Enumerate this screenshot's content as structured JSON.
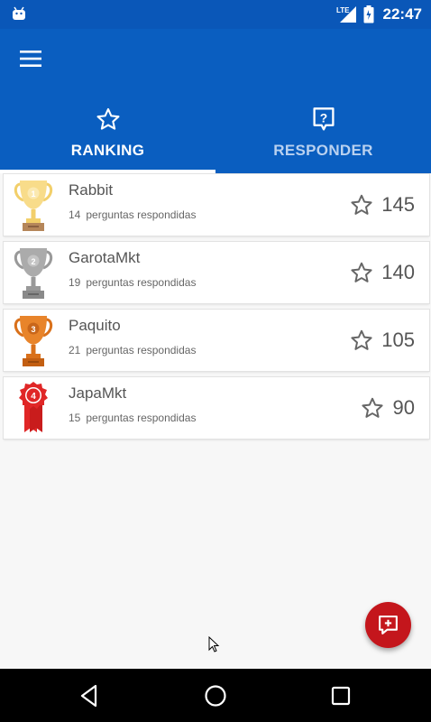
{
  "status_bar": {
    "time": "22:47",
    "network_label": "LTE",
    "icons": [
      "android-icon",
      "lte-signal-icon",
      "battery-icon"
    ]
  },
  "app_bar": {
    "menu_icon": "hamburger-menu-icon",
    "tabs": [
      {
        "label": "RANKING",
        "icon": "star-outline-icon",
        "active": true
      },
      {
        "label": "RESPONDER",
        "icon": "question-bubble-icon",
        "active": false
      }
    ]
  },
  "ranking": {
    "count_suffix": "perguntas respondidas",
    "items": [
      {
        "position": "1",
        "name": "Rabbit",
        "answered": "14",
        "points": "145",
        "badge": "gold-trophy"
      },
      {
        "position": "2",
        "name": "GarotaMkt",
        "answered": "19",
        "points": "140",
        "badge": "silver-trophy"
      },
      {
        "position": "3",
        "name": "Paquito",
        "answered": "21",
        "points": "105",
        "badge": "bronze-trophy"
      },
      {
        "position": "4",
        "name": "JapaMkt",
        "answered": "15",
        "points": "90",
        "badge": "red-ribbon-medal"
      }
    ]
  },
  "fab": {
    "icon": "add-question-icon",
    "color": "#c4161c"
  },
  "navigation_bar": {
    "icons": [
      "back-icon",
      "home-icon",
      "recents-icon"
    ]
  },
  "colors": {
    "primary": "#0a5ec0",
    "status_bar": "#0a57b8",
    "gold": "#f5d67a",
    "silver": "#a7a7a7",
    "bronze": "#e07b22",
    "ribbon": "#e02727"
  }
}
